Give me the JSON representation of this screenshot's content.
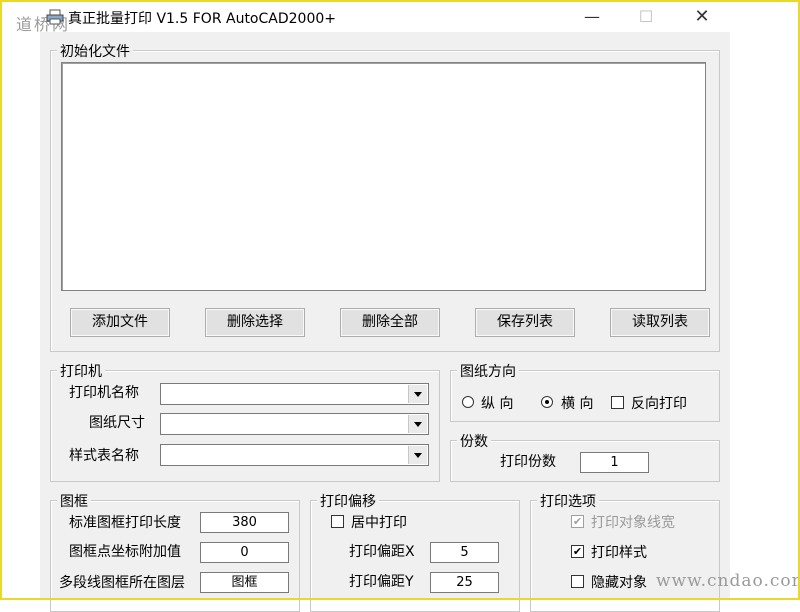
{
  "window": {
    "title": "真正批量打印 V1.5 FOR AutoCAD2000+",
    "minimize_glyph": "—",
    "maximize_glyph": "☐",
    "close_glyph": "✕"
  },
  "watermarks": {
    "top_left": "道桥网",
    "bottom_right": "www.cndao.com"
  },
  "init_files": {
    "group_label": "初始化文件",
    "buttons": {
      "add": "添加文件",
      "delete_selected": "删除选择",
      "delete_all": "删除全部",
      "save_list": "保存列表",
      "read_list": "读取列表"
    }
  },
  "printer": {
    "group_label": "打印机",
    "printer_name_label": "打印机名称",
    "paper_size_label": "图纸尺寸",
    "style_table_label": "样式表名称",
    "printer_name_value": "",
    "paper_size_value": "",
    "style_table_value": ""
  },
  "orientation": {
    "group_label": "图纸方向",
    "portrait_label": "纵 向",
    "landscape_label": "横 向",
    "reverse_label": "反向打印",
    "selected": "landscape"
  },
  "copies": {
    "group_label": "份数",
    "label": "打印份数",
    "value": "1"
  },
  "frame": {
    "group_label": "图框",
    "std_length_label": "标准图框打印长度",
    "std_length_value": "380",
    "coord_add_label": "图框点坐标附加值",
    "coord_add_value": "0",
    "layer_label": "多段线图框所在图层",
    "layer_value": "图框"
  },
  "offset": {
    "group_label": "打印偏移",
    "center_label": "居中打印",
    "offset_x_label": "打印偏距X",
    "offset_x_value": "5",
    "offset_y_label": "打印偏距Y",
    "offset_y_value": "25"
  },
  "options": {
    "group_label": "打印选项",
    "lineweight_label": "打印对象线宽",
    "plotstyle_label": "打印样式",
    "hide_label": "隐藏对象"
  },
  "icons": {
    "app": "printer-icon"
  }
}
